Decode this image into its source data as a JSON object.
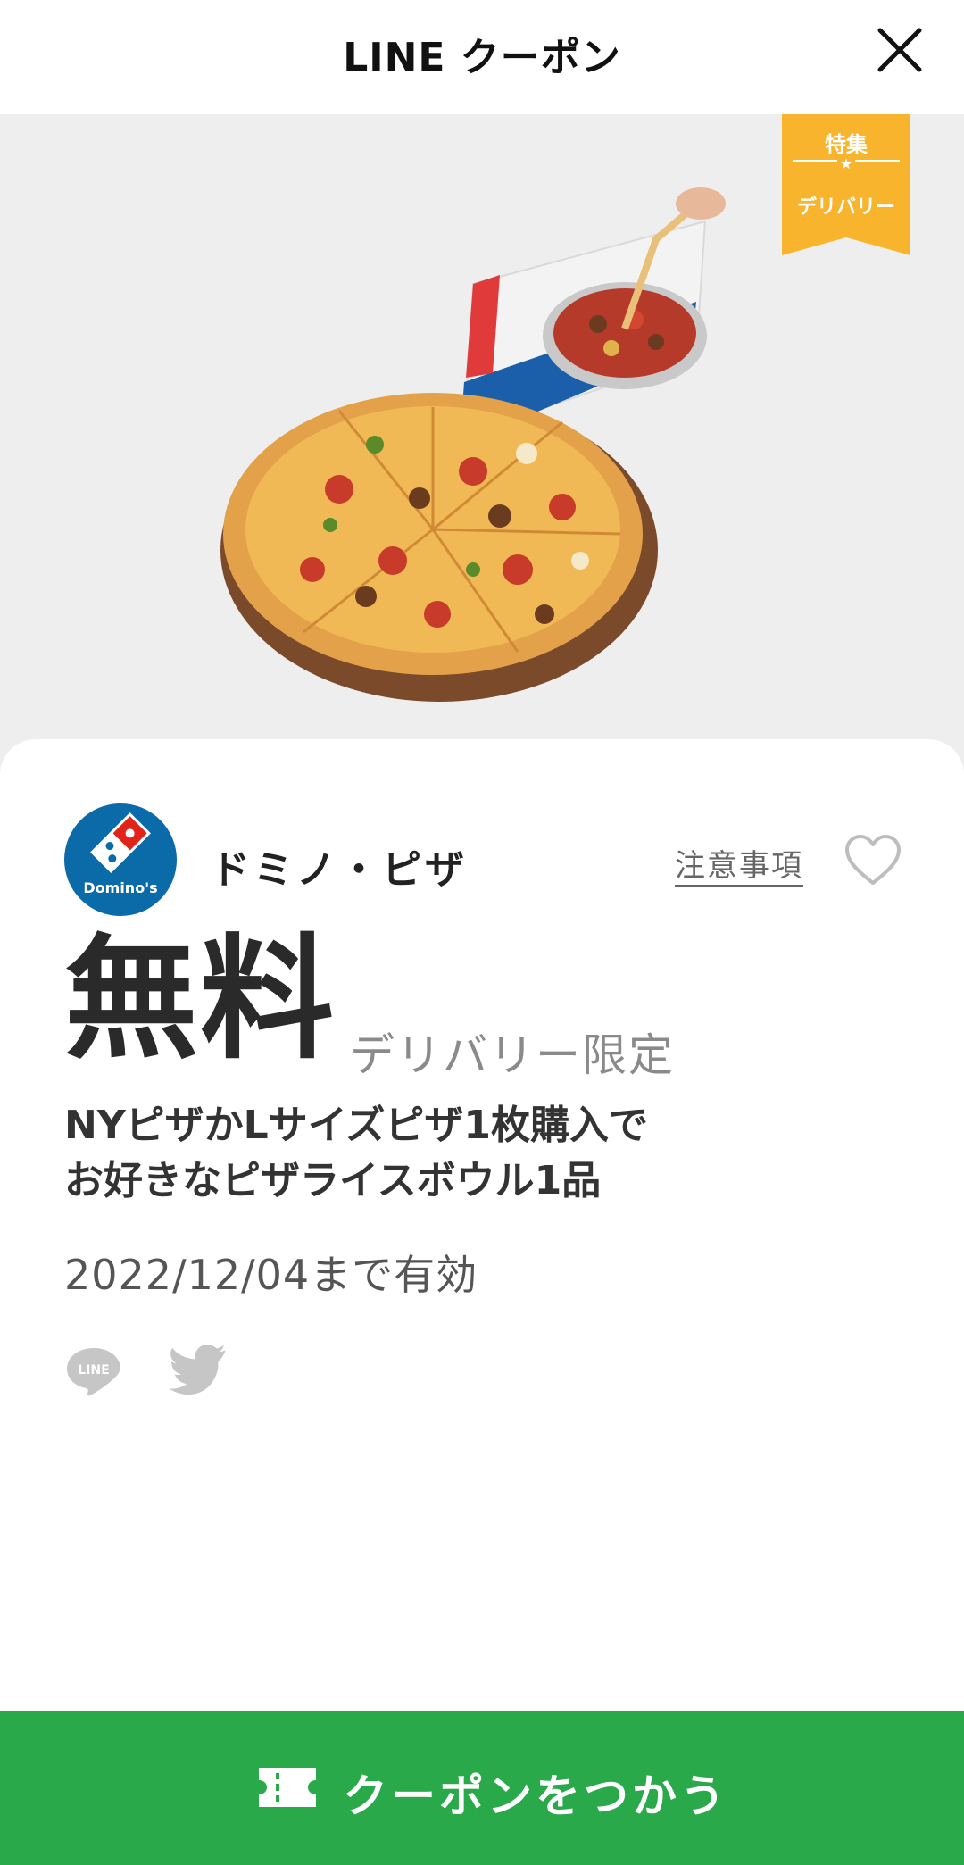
{
  "header": {
    "title": "LINE クーポン",
    "close_icon": "close-icon"
  },
  "hero": {
    "ribbon": {
      "line1": "特集",
      "line2": "デリバリー",
      "color": "#f7b42c"
    },
    "image_desc_icon": "pizza-image"
  },
  "coupon": {
    "brand_name": "ドミノ・ピザ",
    "brand_logo_text": "Domino's",
    "brand_color": "#0b6aa8",
    "notice_label": "注意事項",
    "favorite_icon": "heart-icon",
    "price": "無料",
    "price_note": "デリバリー限定",
    "description_line1": "NYピザかLサイズピザ1枚購入で",
    "description_line2": "お好きなピザライスボウル1品",
    "expiry": "2022/12/04まで有効",
    "share": {
      "line_label": "LINE",
      "twitter_icon": "twitter-icon"
    }
  },
  "action": {
    "use_label": "クーポンをつかう",
    "button_color": "#29a94a",
    "icon": "ticket-icon"
  }
}
